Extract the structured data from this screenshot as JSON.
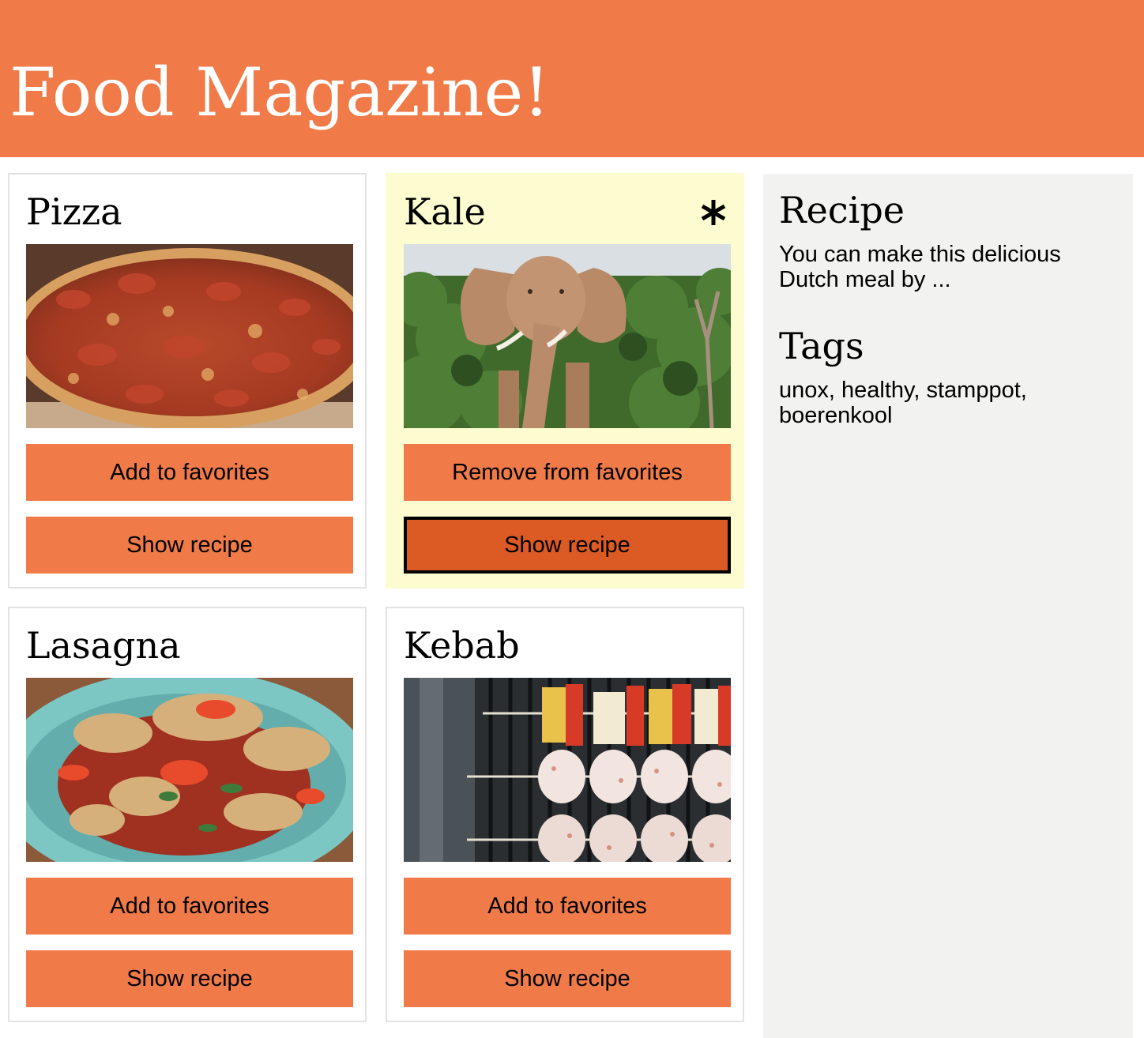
{
  "header": {
    "title": "Food Magazine!",
    "background": "#f07a48"
  },
  "colors": {
    "accent": "#f07a48",
    "accent_active": "#dc5a24",
    "favorite_card": "#fdfbd0",
    "sidebar_bg": "#f2f2f1"
  },
  "cards": [
    {
      "title": "Pizza",
      "image": "pizza-photo",
      "favorite": false,
      "favorite_button": "Add to favorites",
      "show_button": "Show recipe"
    },
    {
      "title": "Kale",
      "image": "elephant-photo",
      "favorite": true,
      "favorite_marker": "*",
      "favorite_button": "Remove from favorites",
      "show_button": "Show recipe",
      "show_button_active": true
    },
    {
      "title": "Lasagna",
      "image": "crab-dish-photo",
      "favorite": false,
      "favorite_button": "Add to favorites",
      "show_button": "Show recipe"
    },
    {
      "title": "Kebab",
      "image": "grill-skewers-photo",
      "favorite": false,
      "favorite_button": "Add to favorites",
      "show_button": "Show recipe"
    }
  ],
  "sidebar": {
    "recipe_heading": "Recipe",
    "recipe_text": "You can make this delicious Dutch meal by ...",
    "tags_heading": "Tags",
    "tags_text": "unox, healthy, stamppot, boerenkool"
  }
}
